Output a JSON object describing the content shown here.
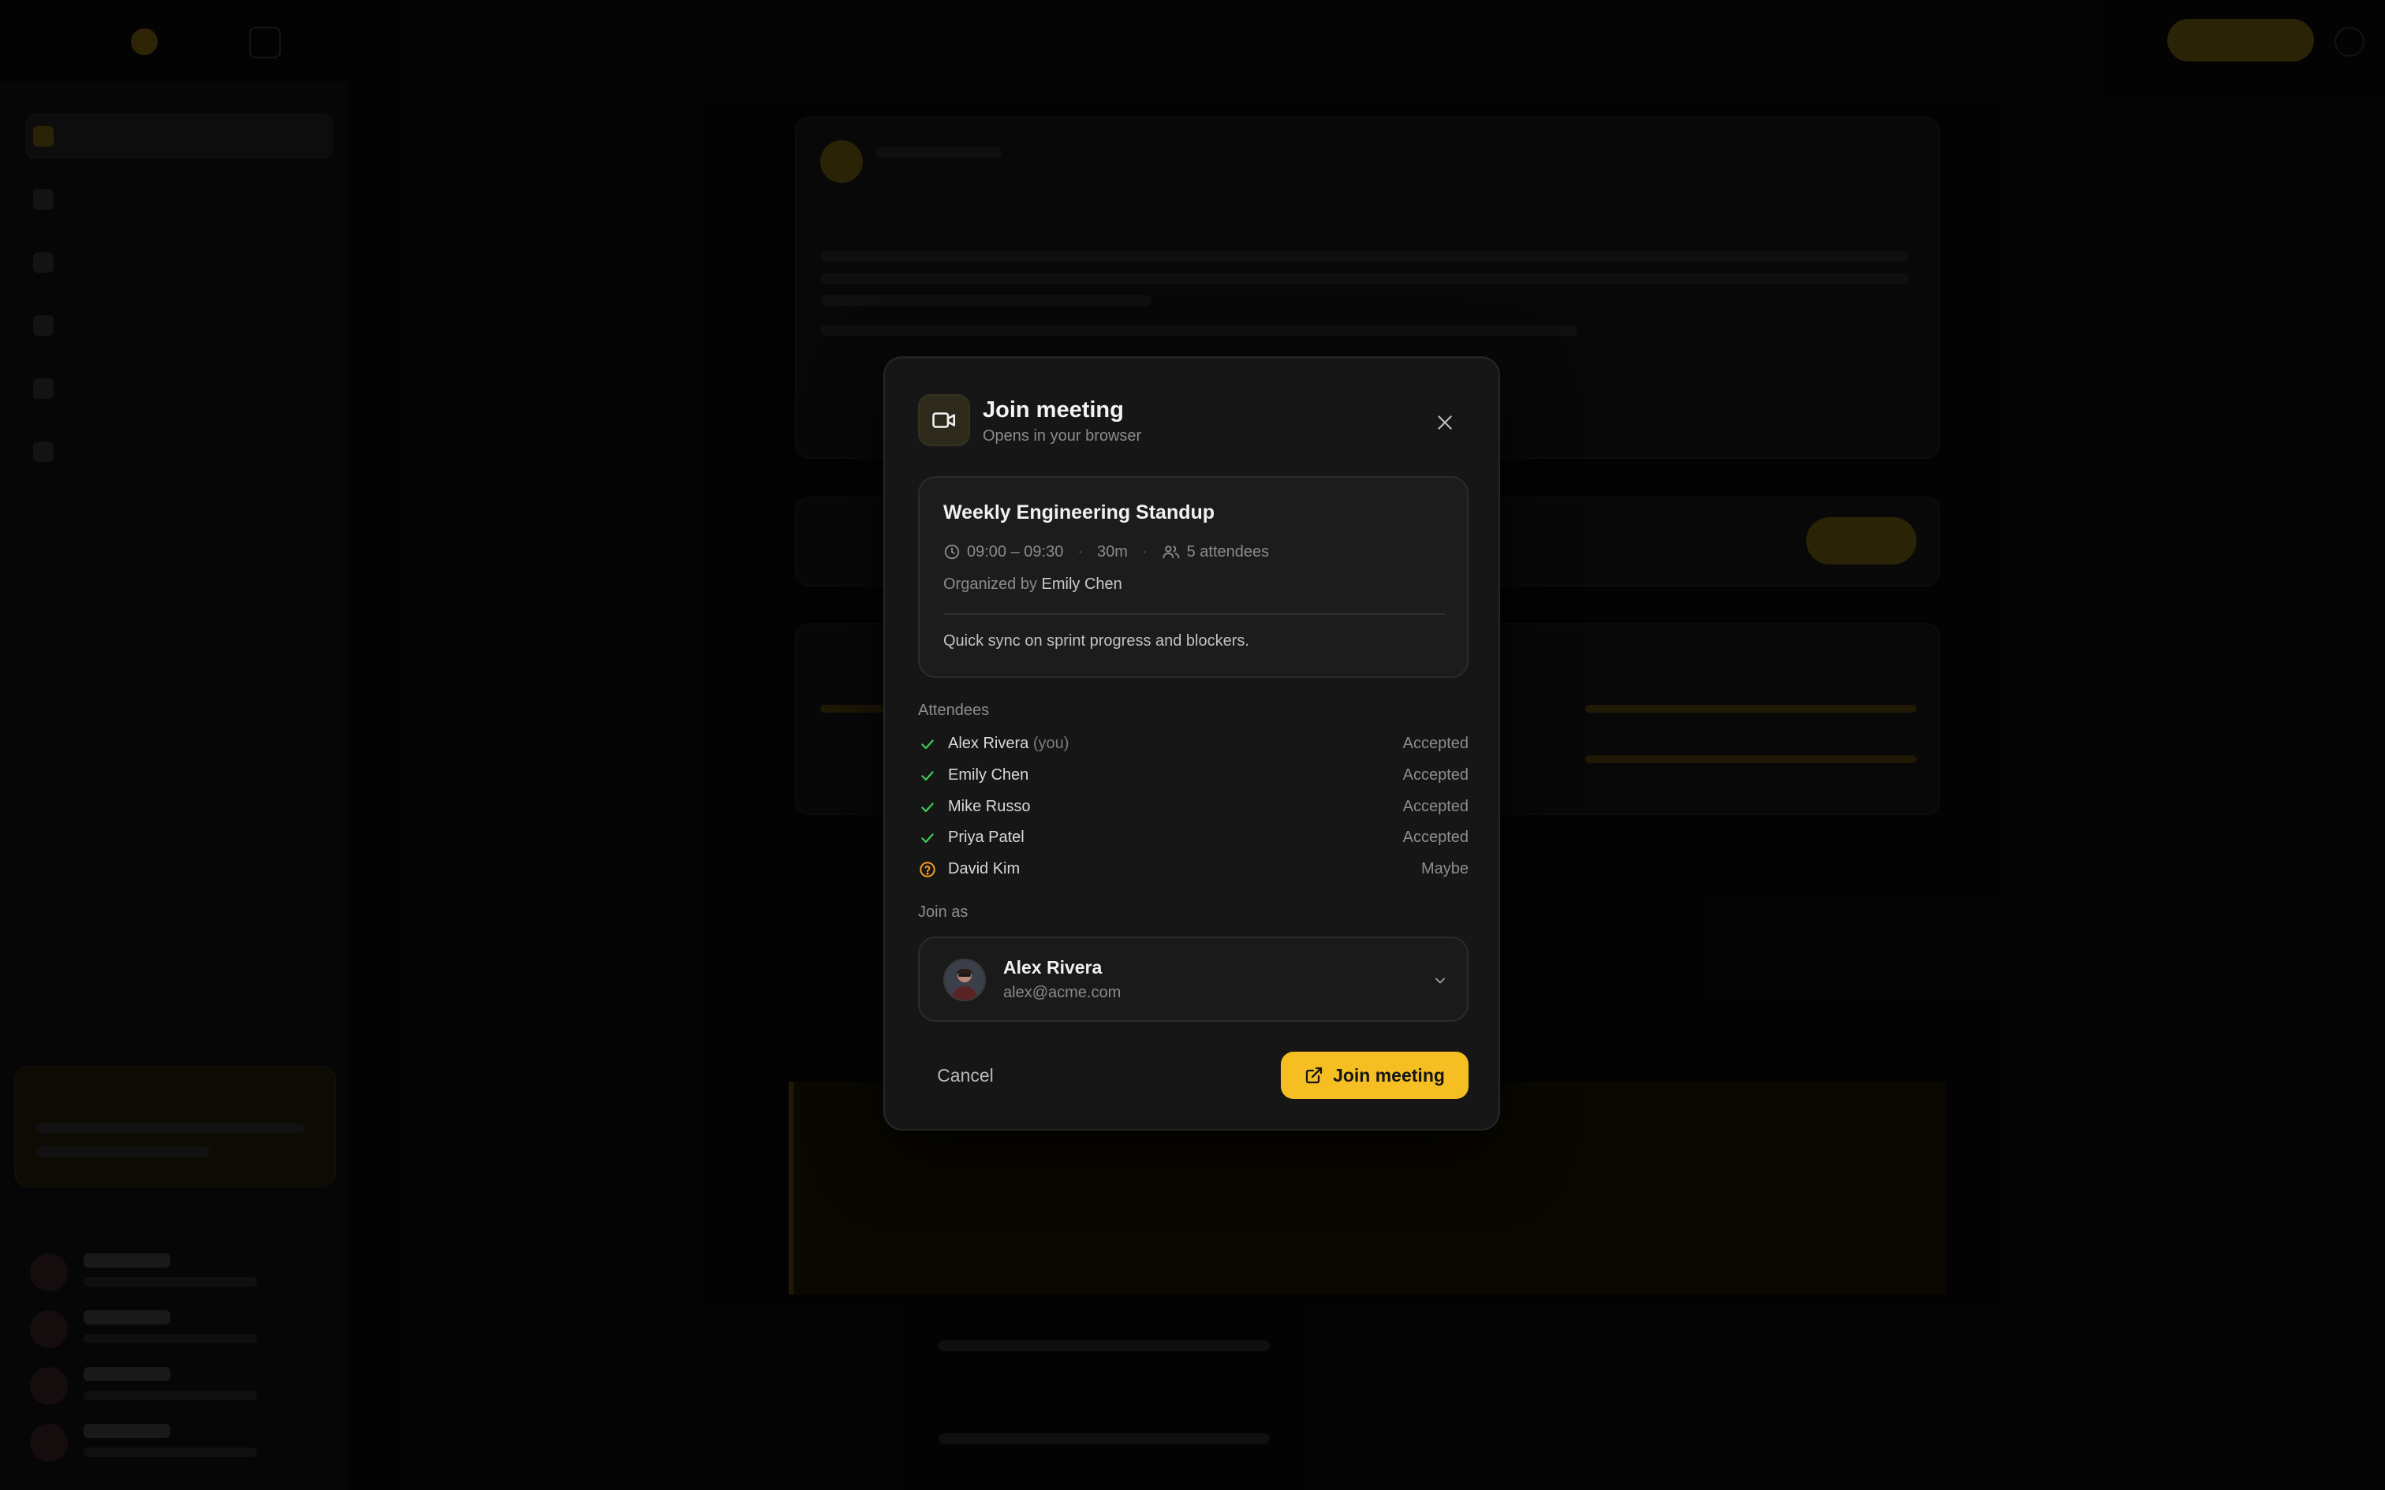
{
  "colors": {
    "accent": "#f5be22",
    "success": "#3ecf5b",
    "warning": "#f0a020",
    "modal_bg": "#161616",
    "backdrop": "#050505"
  },
  "dialog": {
    "title": "Join meeting",
    "subtitle": "Opens in your browser",
    "icon": "video-camera-icon",
    "close_icon": "close-icon"
  },
  "event": {
    "title": "Weekly Engineering Standup",
    "time": "09:00 – 09:30",
    "duration": "30m",
    "attendee_count": "5 attendees",
    "organized_by_label": "Organized by",
    "organizer": "Emily Chen",
    "description": "Quick sync on sprint progress and blockers."
  },
  "attendees_label": "Attendees",
  "attendees": [
    {
      "name": "Alex Rivera",
      "suffix": "(you)",
      "status": "Accepted",
      "icon": "check-icon"
    },
    {
      "name": "Emily Chen",
      "suffix": "",
      "status": "Accepted",
      "icon": "check-icon"
    },
    {
      "name": "Mike Russo",
      "suffix": "",
      "status": "Accepted",
      "icon": "check-icon"
    },
    {
      "name": "Priya Patel",
      "suffix": "",
      "status": "Accepted",
      "icon": "check-icon"
    },
    {
      "name": "David Kim",
      "suffix": "",
      "status": "Maybe",
      "icon": "question-circle-icon"
    }
  ],
  "join_as": {
    "label": "Join as",
    "name": "Alex Rivera",
    "email": "alex@acme.com"
  },
  "actions": {
    "cancel": "Cancel",
    "join": "Join meeting"
  }
}
